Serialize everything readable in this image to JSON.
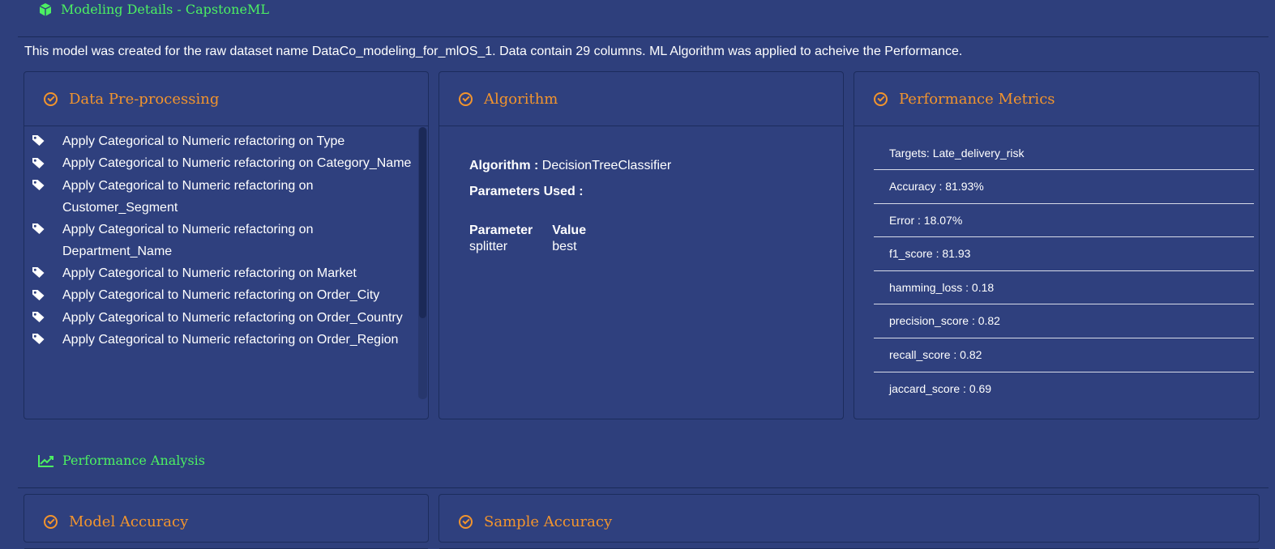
{
  "header": {
    "title": "Modeling Details - CapstoneML",
    "description": "This model was created for the raw dataset name DataCo_modeling_for_mlOS_1. Data contain 29 columns. ML Algorithm was applied to acheive the Performance."
  },
  "preprocessing": {
    "title": "Data Pre-processing",
    "items": [
      "Apply Categorical to Numeric refactoring on Type",
      "Apply Categorical to Numeric refactoring on Category_Name",
      "Apply Categorical to Numeric refactoring on Customer_Segment",
      "Apply Categorical to Numeric refactoring on Department_Name",
      "Apply Categorical to Numeric refactoring on Market",
      "Apply Categorical to Numeric refactoring on Order_City",
      "Apply Categorical to Numeric refactoring on Order_Country",
      "Apply Categorical to Numeric refactoring on Order_Region"
    ]
  },
  "algorithm": {
    "title": "Algorithm",
    "algorithm_label": "Algorithm :",
    "algorithm_value": "DecisionTreeClassifier",
    "params_label": "Parameters Used :",
    "param_header": "Parameter",
    "value_header": "Value",
    "params": [
      {
        "name": "splitter",
        "value": "best"
      }
    ]
  },
  "metrics": {
    "title": "Performance Metrics",
    "items": [
      "Targets: Late_delivery_risk",
      "Accuracy : 81.93%",
      "Error : 18.07%",
      "f1_score : 81.93",
      "hamming_loss : 0.18",
      "precision_score : 0.82",
      "recall_score : 0.82",
      "jaccard_score : 0.69"
    ]
  },
  "analysis": {
    "title": "Performance Analysis",
    "model_accuracy_title": "Model Accuracy",
    "sample_accuracy_title": "Sample Accuracy"
  },
  "colors": {
    "background": "#2e3f7c",
    "section_green": "#4cf062",
    "card_orange": "#f2942d"
  }
}
